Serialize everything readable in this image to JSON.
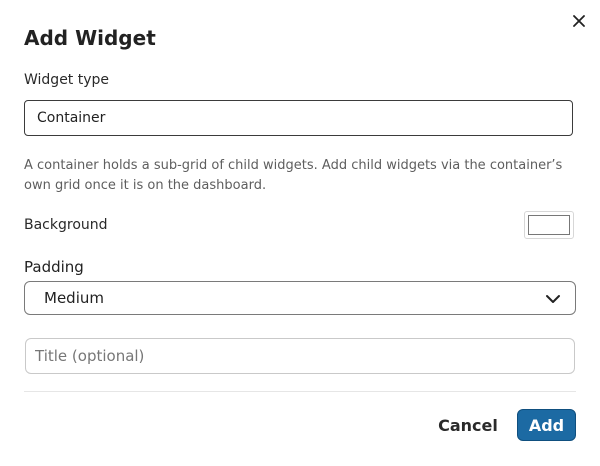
{
  "dialog": {
    "title": "Add Widget",
    "close_icon": "close-icon"
  },
  "widget_type": {
    "label": "Widget type",
    "value": "Container"
  },
  "help_text": "A container holds a sub-grid of child widgets. Add child widgets via the container’s own grid once it is on the dashboard.",
  "background": {
    "label": "Background",
    "color": "#ffffff"
  },
  "padding": {
    "label": "Padding",
    "selected": "Medium",
    "icon": "chevron-down-icon"
  },
  "title_field": {
    "value": "",
    "placeholder": "Title (optional)"
  },
  "actions": {
    "cancel_label": "Cancel",
    "add_label": "Add"
  },
  "colors": {
    "primary": "#1c6aa3",
    "primary_border": "#0f4f7f",
    "text": "#222222",
    "muted_text": "#5e5e5e"
  }
}
